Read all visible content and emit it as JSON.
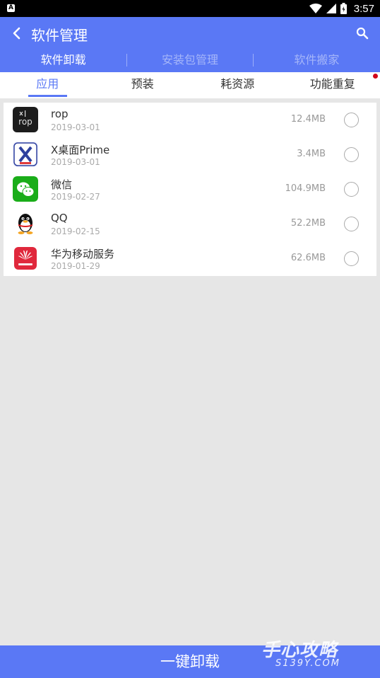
{
  "status_bar": {
    "time": "3:57"
  },
  "app_bar": {
    "title": "软件管理"
  },
  "top_tabs": [
    {
      "label": "软件卸载",
      "active": true
    },
    {
      "label": "安装包管理",
      "active": false
    },
    {
      "label": "软件搬家",
      "active": false
    }
  ],
  "sub_tabs": [
    {
      "label": "应用",
      "active": true
    },
    {
      "label": "预装",
      "active": false
    },
    {
      "label": "耗资源",
      "active": false
    },
    {
      "label": "功能重复",
      "active": false,
      "badge": true
    }
  ],
  "apps": [
    {
      "name": "rop",
      "date": "2019-03-01",
      "size": "12.4MB",
      "icon": "rop-app-icon",
      "selected": false
    },
    {
      "name": "X桌面Prime",
      "date": "2019-03-01",
      "size": "3.4MB",
      "icon": "x-launcher-icon",
      "selected": false
    },
    {
      "name": "微信",
      "date": "2019-02-27",
      "size": "104.9MB",
      "icon": "wechat-icon",
      "selected": false
    },
    {
      "name": "QQ",
      "date": "2019-02-15",
      "size": "52.2MB",
      "icon": "qq-penguin-icon",
      "selected": false
    },
    {
      "name": "华为移动服务",
      "date": "2019-01-29",
      "size": "62.6MB",
      "icon": "huawei-icon",
      "selected": false
    }
  ],
  "bottom": {
    "uninstall_label": "一键卸载"
  },
  "watermark": {
    "text": "手心攻略",
    "sub": "S139Y.COM"
  },
  "colors": {
    "primary": "#5a78f5",
    "background": "#e6e6e6",
    "badge": "#d0021b"
  }
}
